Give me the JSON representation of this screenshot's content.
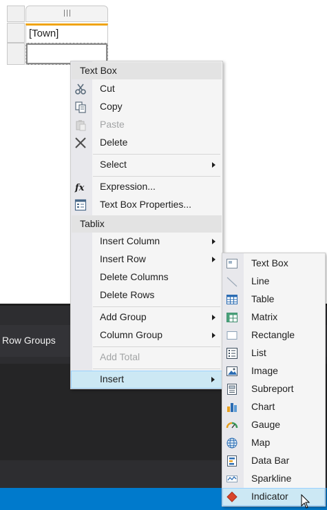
{
  "tablix": {
    "cell_value": "[Town]"
  },
  "bottom_pane": {
    "row_groups_label": "Row Groups"
  },
  "context_menu": {
    "text_box_header": "Text Box",
    "cut": "Cut",
    "copy": "Copy",
    "paste": "Paste",
    "delete": "Delete",
    "select": "Select",
    "expression": "Expression...",
    "text_box_properties": "Text Box Properties...",
    "tablix_header": "Tablix",
    "insert_column": "Insert Column",
    "insert_row": "Insert Row",
    "delete_columns": "Delete Columns",
    "delete_rows": "Delete Rows",
    "add_group": "Add Group",
    "column_group": "Column Group",
    "add_total": "Add Total",
    "insert": "Insert"
  },
  "insert_submenu": {
    "items": [
      {
        "label": "Text Box",
        "icon": "textbox-icon"
      },
      {
        "label": "Line",
        "icon": "line-icon"
      },
      {
        "label": "Table",
        "icon": "table-icon"
      },
      {
        "label": "Matrix",
        "icon": "matrix-icon"
      },
      {
        "label": "Rectangle",
        "icon": "rectangle-icon"
      },
      {
        "label": "List",
        "icon": "list-icon"
      },
      {
        "label": "Image",
        "icon": "image-icon"
      },
      {
        "label": "Subreport",
        "icon": "subreport-icon"
      },
      {
        "label": "Chart",
        "icon": "chart-icon"
      },
      {
        "label": "Gauge",
        "icon": "gauge-icon"
      },
      {
        "label": "Map",
        "icon": "map-icon"
      },
      {
        "label": "Data Bar",
        "icon": "databar-icon"
      },
      {
        "label": "Sparkline",
        "icon": "sparkline-icon"
      },
      {
        "label": "Indicator",
        "icon": "indicator-icon"
      }
    ]
  },
  "colors": {
    "accent_blue": "#007acc",
    "selection_orange": "#f0a30a",
    "menu_highlight": "#cce8f4",
    "dark_pane": "#2d2d30"
  }
}
